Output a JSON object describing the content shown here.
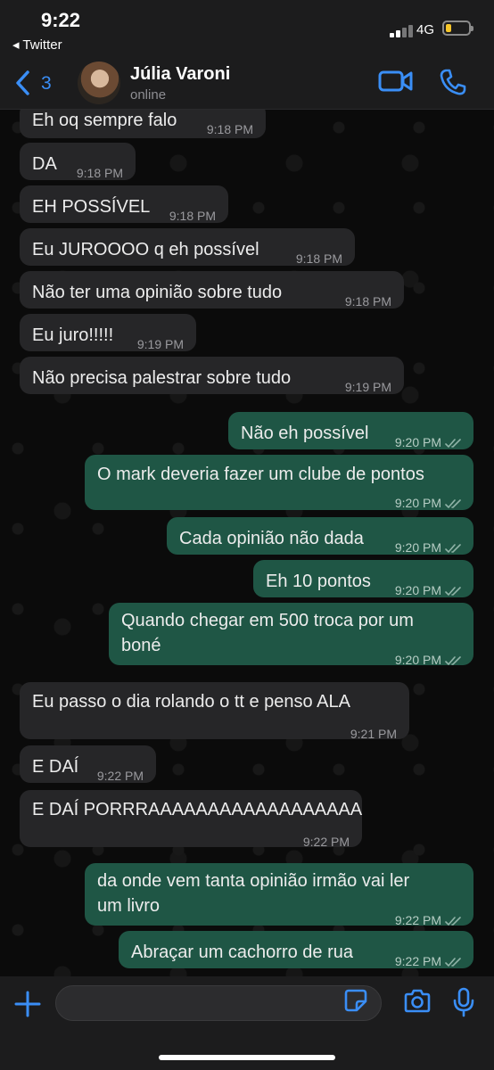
{
  "status_bar": {
    "time": "9:22",
    "back_app": "◂ Twitter",
    "network": "4G",
    "battery_fraction": 0.25
  },
  "header": {
    "back_count": "3",
    "contact_name": "Júlia Varoni",
    "contact_status": "online"
  },
  "messages": [
    {
      "dir": "in",
      "text": "Eh oq sempre falo",
      "time": "9:18 PM"
    },
    {
      "dir": "in",
      "text": "DA",
      "time": "9:18 PM"
    },
    {
      "dir": "in",
      "text": "EH POSSÍVEL",
      "time": "9:18 PM"
    },
    {
      "dir": "in",
      "text": "Eu JUROOOO q eh possível",
      "time": "9:18 PM"
    },
    {
      "dir": "in",
      "text": "Não ter uma opinião sobre tudo",
      "time": "9:18 PM"
    },
    {
      "dir": "in",
      "text": "Eu juro!!!!!",
      "time": "9:19 PM"
    },
    {
      "dir": "in",
      "text": "Não precisa palestrar sobre tudo",
      "time": "9:19 PM"
    },
    {
      "dir": "out",
      "text": "Não eh possível",
      "time": "9:20 PM"
    },
    {
      "dir": "out",
      "text": "O mark deveria fazer um clube de pontos",
      "time": "9:20 PM"
    },
    {
      "dir": "out",
      "text": "Cada opinião não dada",
      "time": "9:20 PM"
    },
    {
      "dir": "out",
      "text": "Eh 10 pontos",
      "time": "9:20 PM"
    },
    {
      "dir": "out",
      "text": "Quando chegar em 500 troca por um",
      "text2": "boné",
      "time": "9:20 PM"
    },
    {
      "dir": "in",
      "text": "Eu passo o dia rolando o tt e penso ALA",
      "time": "9:21 PM"
    },
    {
      "dir": "in",
      "text": "E DAÍ",
      "time": "9:22 PM"
    },
    {
      "dir": "in",
      "text": "E DAÍ PORRRAAAAAAAAAAAAAAAAAA",
      "time": "9:22 PM"
    },
    {
      "dir": "out",
      "text": "da onde vem tanta opinião irmão vai ler",
      "text2": "um livro",
      "time": "9:22 PM"
    },
    {
      "dir": "out",
      "text": "Abraçar um cachorro de rua",
      "time": "9:22 PM"
    }
  ],
  "input": {
    "placeholder": ""
  },
  "colors": {
    "accent": "#3a8ef6",
    "incoming_bubble": "#262628",
    "outgoing_bubble": "#1f5645"
  }
}
